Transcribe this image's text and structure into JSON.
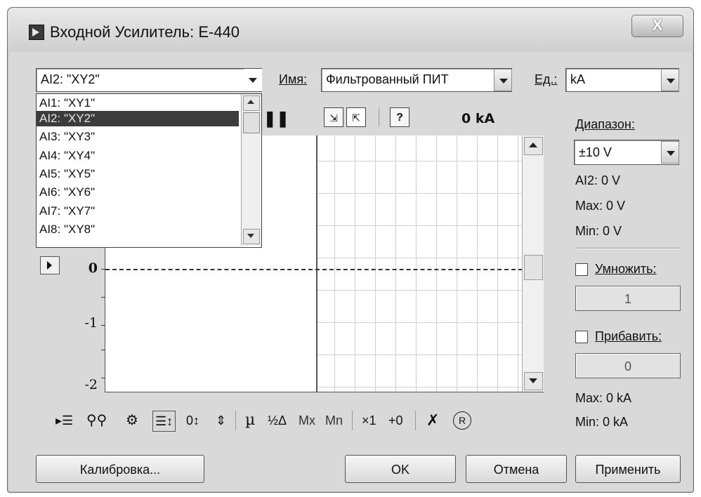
{
  "window": {
    "title": "Входной Усилитель: E-440",
    "close_label": "X"
  },
  "channel_select": {
    "value": "AI2: \"XY2\""
  },
  "channel_list": {
    "items": [
      "AI1: \"XY1\"",
      "AI2: \"XY2\"",
      "AI3: \"XY3\"",
      "AI4: \"XY4\"",
      "AI5: \"XY5\"",
      "AI6: \"XY6\"",
      "AI7: \"XY7\"",
      "AI8: \"XY8\""
    ],
    "selected_index": 1
  },
  "name_field": {
    "label": "Имя:",
    "value": "Фильтрованный ПИТ"
  },
  "units_field": {
    "label": "Ед.:",
    "value": "kA"
  },
  "toolbar": {
    "readout": "0 kA",
    "help_label": "?"
  },
  "plot": {
    "y_ticks": [
      "0",
      "-1",
      "-2"
    ]
  },
  "right_panel": {
    "range_label": "Диапазон:",
    "range_value": "±10 V",
    "ai_value": "AI2:  0 V",
    "max_v": "Max:  0 V",
    "min_v": "Min:  0 V",
    "multiply_label": "Умножить:",
    "multiply_value": "1",
    "multiply_checked": false,
    "add_label": "Прибавить:",
    "add_value": "0",
    "add_checked": false,
    "max_ka": "Max:  0 kA",
    "min_ka": "Min:  0 kA"
  },
  "bottom_toolbar": {
    "mu": "µ",
    "half_delta": "½Δ",
    "mx": "Mx",
    "mn": "Mn",
    "x1": "×1",
    "plus0": "+0",
    "r_badge": "R"
  },
  "buttons": {
    "calibration": "Калибровка...",
    "ok": "OK",
    "cancel": "Отмена",
    "apply": "Применить"
  }
}
